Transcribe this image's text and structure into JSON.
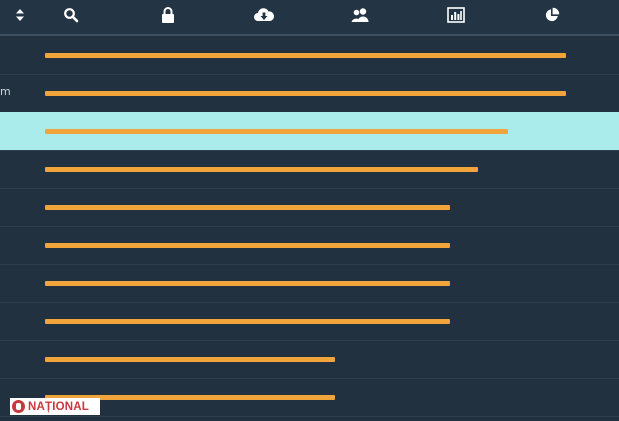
{
  "toolbar": {
    "icons": [
      "sort-icon",
      "search-icon",
      "lock-icon",
      "cloud-download-icon",
      "users-icon",
      "bar-chart-icon",
      "pie-chart-icon"
    ]
  },
  "colors": {
    "background": "#22313f",
    "bar": "#f0a43a",
    "selected_row": "#aaeceb",
    "icon": "#ffffff"
  },
  "rows": [
    {
      "label": "",
      "value": 0.84,
      "selected": false
    },
    {
      "label": "m",
      "value": 0.84,
      "selected": false
    },
    {
      "label": "",
      "value": 0.746,
      "selected": true
    },
    {
      "label": "",
      "value": 0.699,
      "selected": false
    },
    {
      "label": "",
      "value": 0.654,
      "selected": false
    },
    {
      "label": "",
      "value": 0.654,
      "selected": false
    },
    {
      "label": "",
      "value": 0.654,
      "selected": false
    },
    {
      "label": "",
      "value": 0.654,
      "selected": false
    },
    {
      "label": "",
      "value": 0.467,
      "selected": false
    },
    {
      "label": "",
      "value": 0.467,
      "selected": false
    }
  ],
  "watermark": {
    "text": "NAȚIONAL"
  }
}
